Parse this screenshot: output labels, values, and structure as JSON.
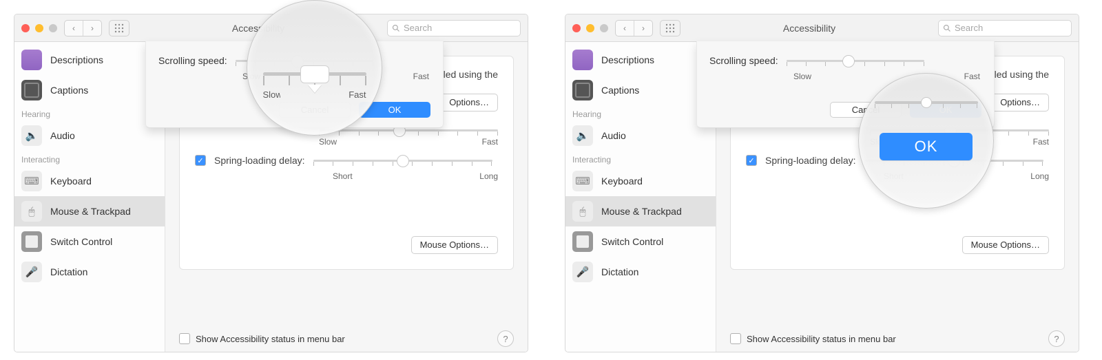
{
  "title": "Accessibility",
  "search_placeholder": "Search",
  "sidebar": {
    "items": [
      {
        "label": "Descriptions"
      },
      {
        "label": "Captions"
      }
    ],
    "hearing_label": "Hearing",
    "audio_label": "Audio",
    "interacting_label": "Interacting",
    "keyboard_label": "Keyboard",
    "mouse_label": "Mouse & Trackpad",
    "switch_label": "Switch Control",
    "dictation_label": "Dictation"
  },
  "main": {
    "controlled_text": "controlled using the",
    "options_label": "Options…",
    "slow_label": "Slow",
    "fast_label": "Fast",
    "spring_label": "Spring-loading delay:",
    "short_label": "Short",
    "long_label": "Long",
    "mouse_options_label": "Mouse Options…"
  },
  "sheet": {
    "scrolling_label": "Scrolling speed:",
    "slow": "Slow",
    "fast": "Fast",
    "cancel": "Cancel",
    "ok": "OK"
  },
  "footer": {
    "status_label": "Show Accessibility status in menu bar"
  },
  "callout_left": {
    "left_partial": "Slow",
    "right_partial": "Fast"
  },
  "callout_right": {
    "ok": "OK"
  }
}
